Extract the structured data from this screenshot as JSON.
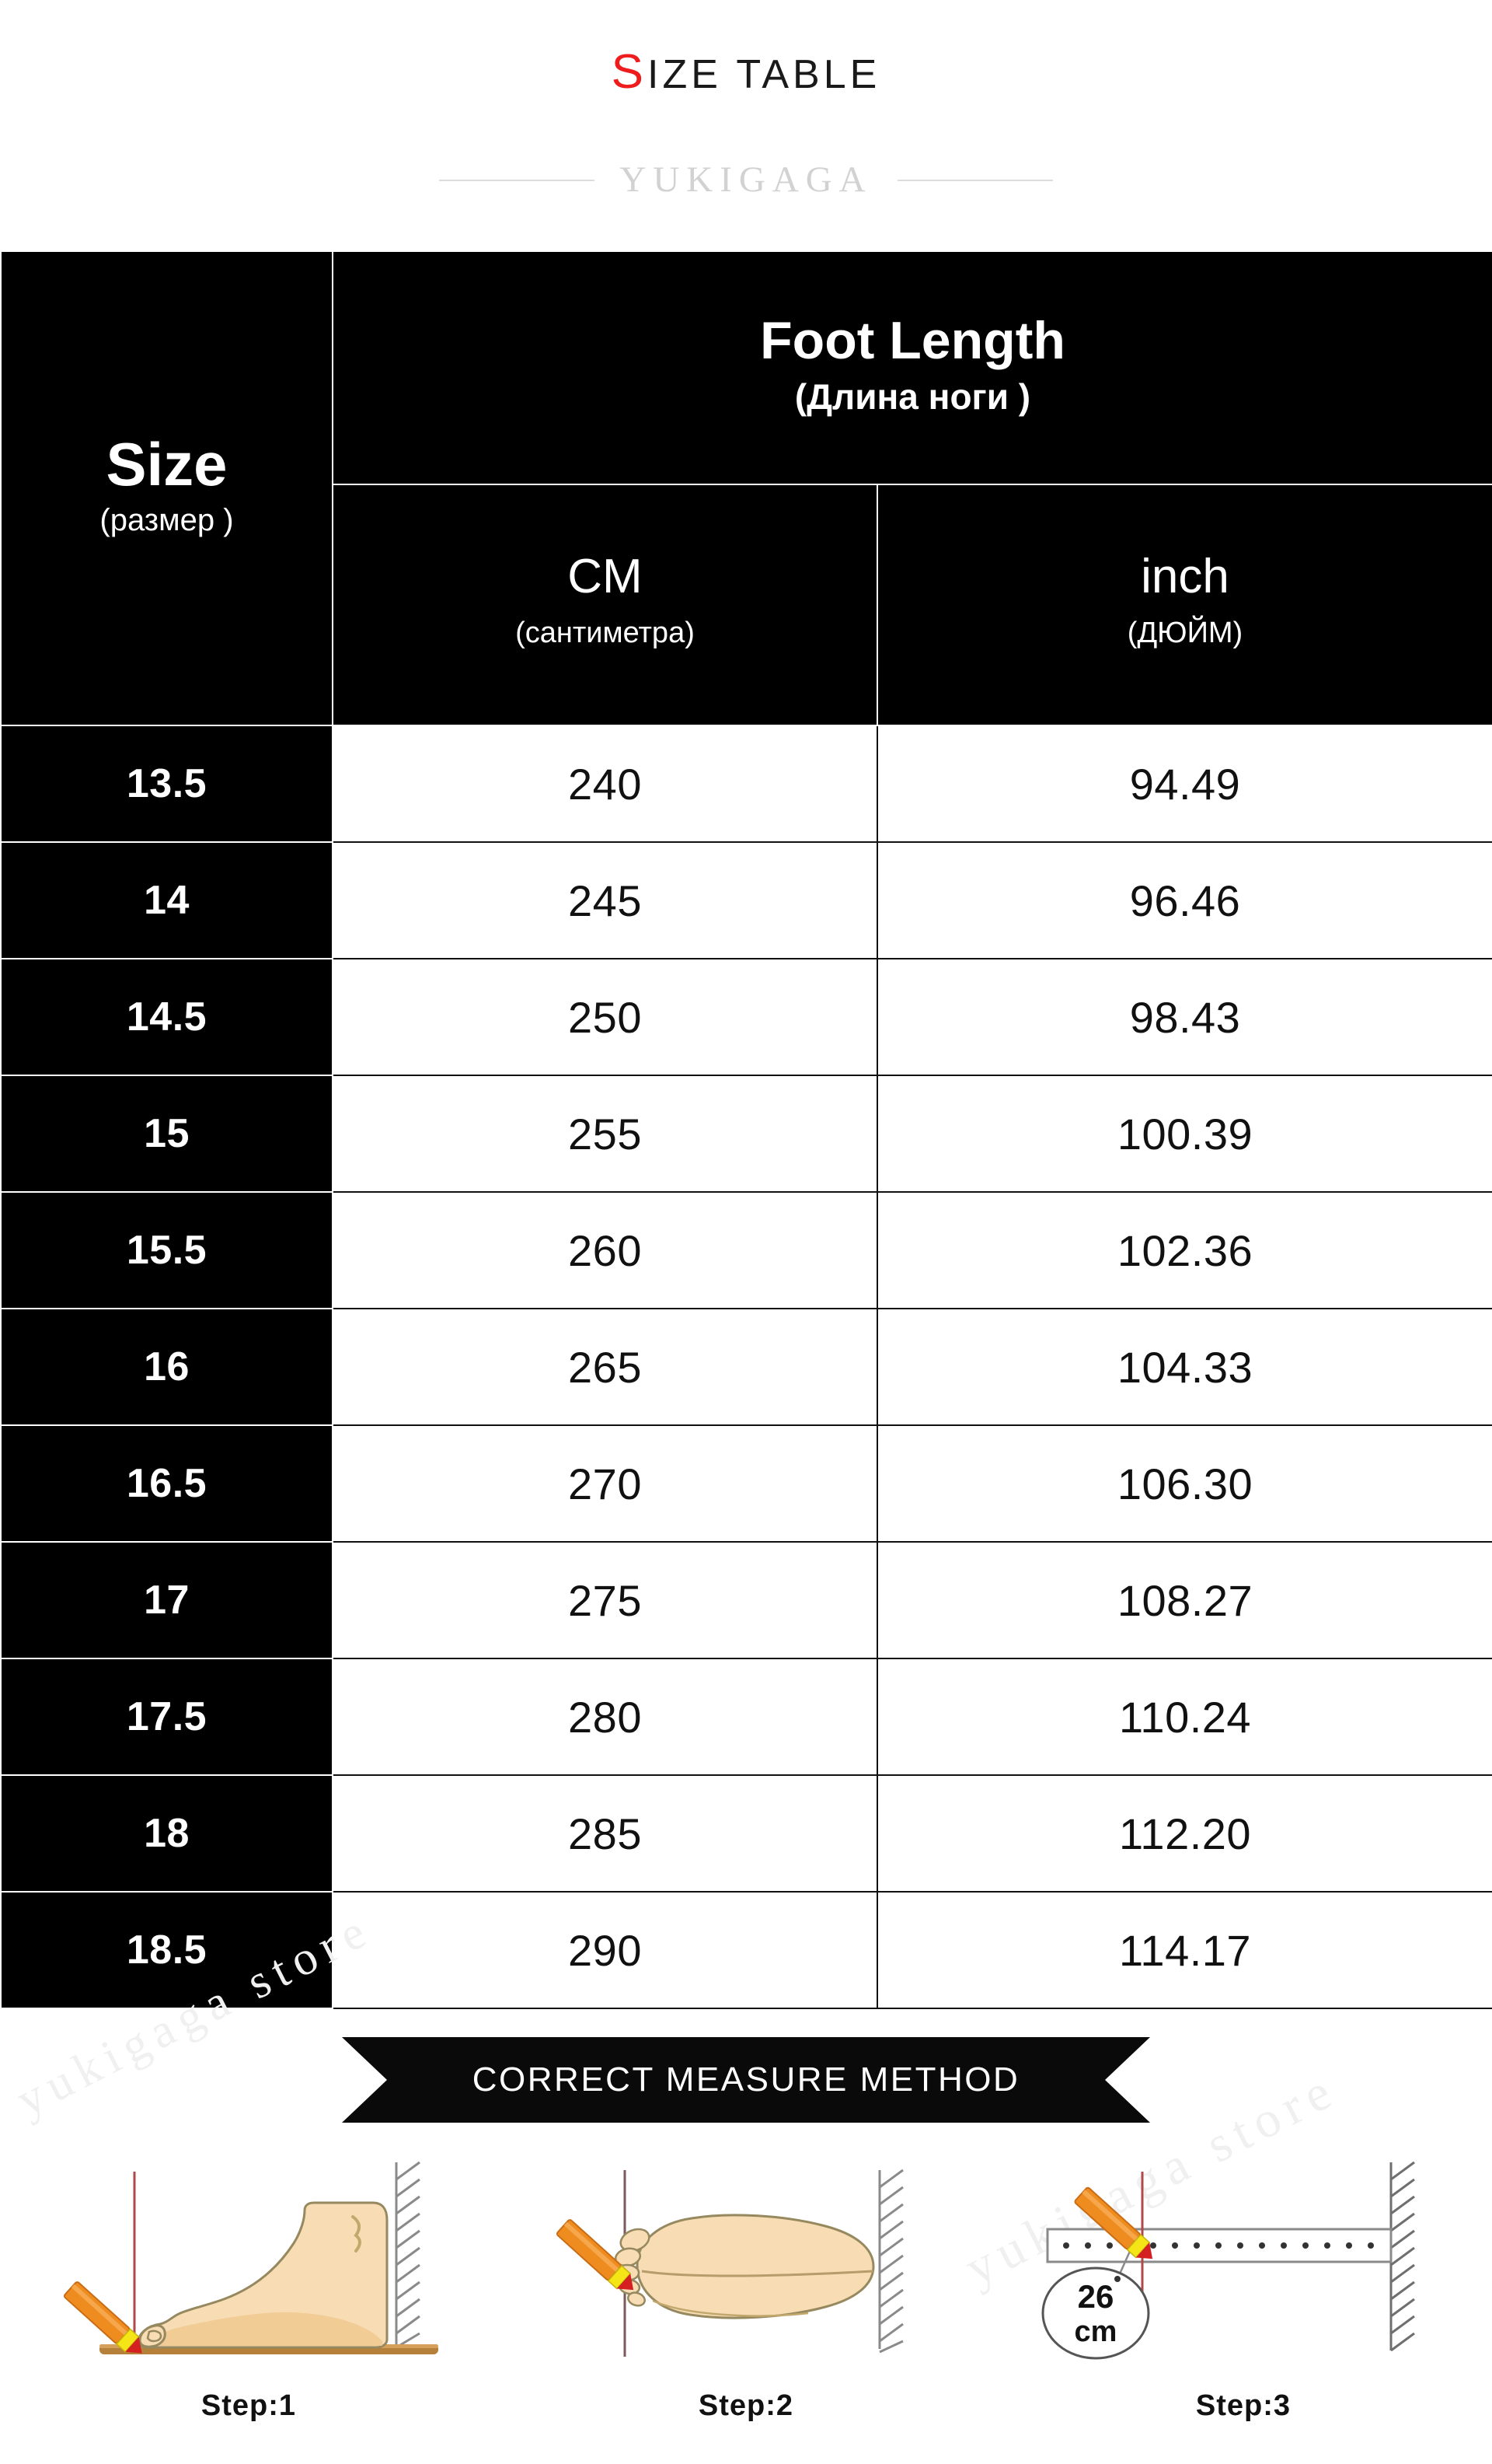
{
  "header": {
    "title_accent": "S",
    "title_rest": "IZE TABLE",
    "brand": "YUKIGAGA"
  },
  "table": {
    "columns": {
      "size_label": "Size",
      "size_sub": "(размер )",
      "foot_length_label": "Foot Length",
      "foot_length_sub": "(Длина ноги )",
      "cm_label": "CM",
      "cm_sub": "(сантиметра)",
      "inch_label": "inch",
      "inch_sub": "(ДЮЙМ)"
    },
    "rows": [
      {
        "size": "13.5",
        "cm": "240",
        "inch": "94.49"
      },
      {
        "size": "14",
        "cm": "245",
        "inch": "96.46"
      },
      {
        "size": "14.5",
        "cm": "250",
        "inch": "98.43"
      },
      {
        "size": "15",
        "cm": "255",
        "inch": "100.39"
      },
      {
        "size": "15.5",
        "cm": "260",
        "inch": "102.36"
      },
      {
        "size": "16",
        "cm": "265",
        "inch": "104.33"
      },
      {
        "size": "16.5",
        "cm": "270",
        "inch": "106.30"
      },
      {
        "size": "17",
        "cm": "275",
        "inch": "108.27"
      },
      {
        "size": "17.5",
        "cm": "280",
        "inch": "110.24"
      },
      {
        "size": "18",
        "cm": "285",
        "inch": "112.20"
      },
      {
        "size": "18.5",
        "cm": "290",
        "inch": "114.17"
      }
    ]
  },
  "measure": {
    "banner": "CORRECT MEASURE METHOD",
    "watermark": "yukigaga store",
    "steps": [
      {
        "label": "Step:1"
      },
      {
        "label": "Step:2"
      },
      {
        "label": "Step:3"
      }
    ],
    "ruler_callout": "26",
    "ruler_callout_unit": "cm"
  },
  "colors": {
    "accent_red": "#ee1c1c",
    "table_black": "#000000",
    "brand_gray": "#d2d2d2",
    "skin": "#f7dcb4",
    "skin_shadow": "#f0c98f",
    "pencil_orange": "#ef8c20",
    "pencil_yellow": "#f5e516",
    "pencil_tip_red": "#d42020",
    "floor_brown": "#b5803a",
    "wall_gray": "#8a8a8a",
    "guide_line": "#b04a4a"
  }
}
